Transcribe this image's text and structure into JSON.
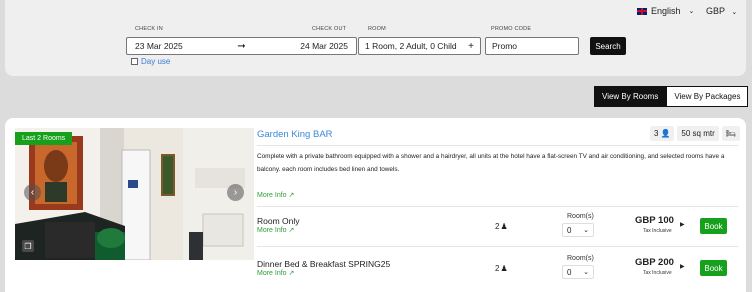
{
  "header": {
    "language": "English",
    "currency": "GBP",
    "check_in_label": "CHECK IN",
    "check_out_label": "CHECK OUT",
    "room_label": "ROOM",
    "promo_label": "PROMO CODE",
    "check_in_value": "23 Mar 2025",
    "check_out_value": "24 Mar 2025",
    "room_value": "1 Room, 2 Adult, 0 Child",
    "promo_value": "Promo",
    "search_label": "Search",
    "day_use_label": "Day use"
  },
  "view_tabs": {
    "rooms": "View By Rooms",
    "packages": "View By Packages"
  },
  "room": {
    "badge": "Last 2 Rooms",
    "name": "Garden King BAR",
    "occupancy": "3",
    "size": "50 sq mtr",
    "description": "Complete with a private bathroom equipped with a shower and a hairdryer, all units at the hotel have a flat-screen TV and air conditioning, and selected rooms have a balcony. each room includes bed linen and towels.",
    "more_info": "More Info"
  },
  "rates": [
    {
      "name": "Room Only",
      "more_info": "More Info",
      "occupancy": "2",
      "rooms_label": "Room(s)",
      "rooms_value": "0",
      "price": "GBP 100",
      "tax": "Tax Inclusive",
      "book": "Book"
    },
    {
      "name": "Dinner Bed & Breakfast SPRING25",
      "more_info": "More Info",
      "occupancy": "2",
      "rooms_label": "Room(s)",
      "rooms_value": "0",
      "price": "GBP 200",
      "tax": "Tax Inclusive",
      "book": "Book"
    }
  ]
}
